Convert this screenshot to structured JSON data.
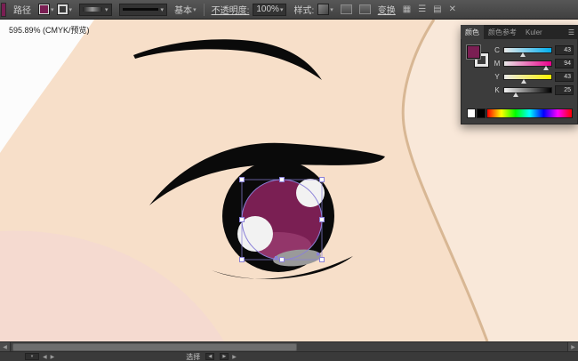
{
  "toolbar": {
    "object_label": "路径",
    "brush_label": "基本",
    "opacity_label": "不透明度:",
    "opacity_value": "100%",
    "style_label": "样式:",
    "transform_label": "变换"
  },
  "document": {
    "zoom_title": "595.89% (CMYK/预览)"
  },
  "color_panel": {
    "tabs": [
      {
        "label": "颜色"
      },
      {
        "label": "颜色参考"
      },
      {
        "label": "Kuler"
      }
    ],
    "sliders": [
      {
        "label": "C",
        "value": "43",
        "pos": "40%"
      },
      {
        "label": "M",
        "value": "94",
        "pos": "88%"
      },
      {
        "label": "Y",
        "value": "43",
        "pos": "42%"
      },
      {
        "label": "K",
        "value": "25",
        "pos": "24%"
      }
    ]
  },
  "status_bar": {
    "tool_status": "选择"
  },
  "colors": {
    "ink": "#0a0a0a",
    "skin": "#f7dfc9",
    "skin_light": "#f9e8d9",
    "contour": "#d8b794",
    "blush": "#f5d9d1",
    "page_white": "#fcfcfc",
    "iris": "#7a1f53",
    "iris_light": "#93366a",
    "highlight_white": "#f2f2f2",
    "shadow_gray": "#9a9a9a",
    "selection": "#8a80d8"
  }
}
